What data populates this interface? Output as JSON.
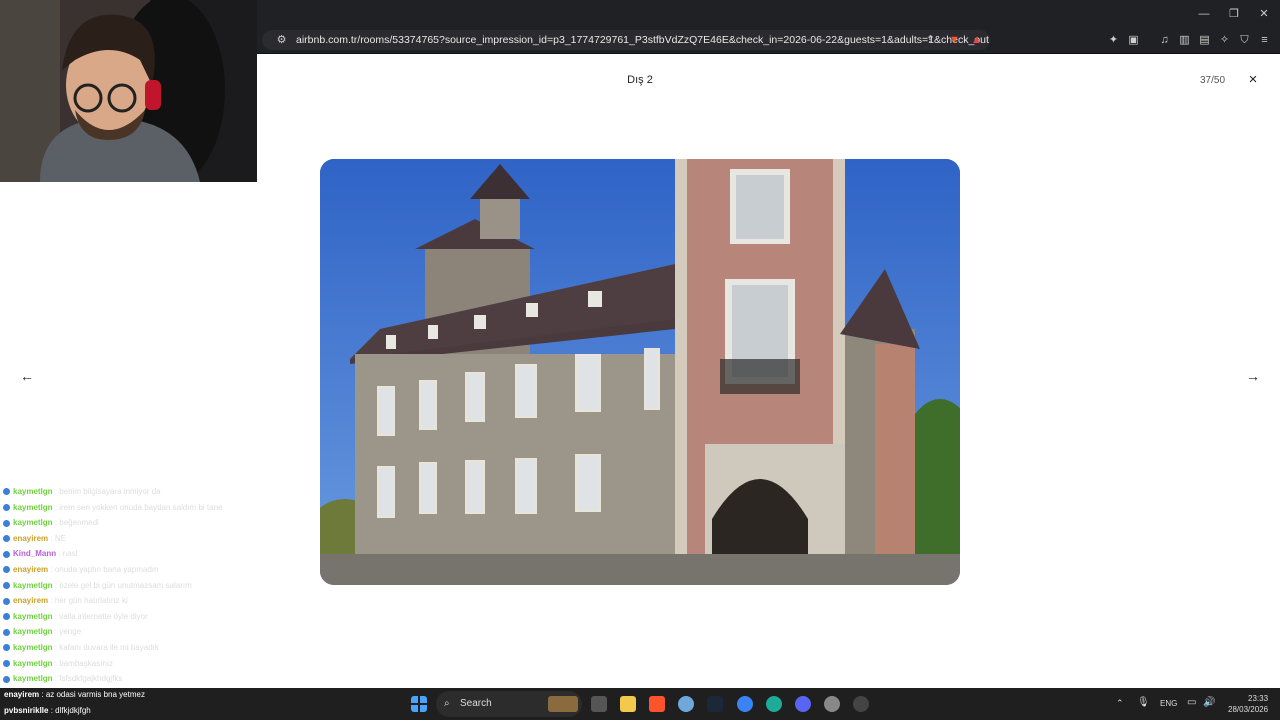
{
  "browser": {
    "url": "airbnb.com.tr/rooms/53374765?source_impression_id=p3_1774729761_P3stfbVdZzQ7E46E&check_in=2026-06-22&guests=1&adults=1&check_out..."
  },
  "viewer": {
    "title": "Dış 2",
    "counter": "37/50",
    "close_icon": "×",
    "prev_icon": "←",
    "next_icon": "→"
  },
  "chat": {
    "messages": [
      {
        "user": "kaymetlgn",
        "text": "benim bilgisayara inmiyor da",
        "color": "#6fd13f"
      },
      {
        "user": "kaymetlgn",
        "text": "irem sen yokken onuda baydan saldım bi tane",
        "color": "#6fd13f"
      },
      {
        "user": "kaymetlgn",
        "text": "beğenmedi",
        "color": "#6fd13f"
      },
      {
        "user": "enayirem",
        "text": "NE",
        "color": "#c9a227"
      },
      {
        "user": "Kind_Mann",
        "text": "nasl",
        "color": "#b85de0"
      },
      {
        "user": "enayirem",
        "text": "onuda yaptın bana yapmadın",
        "color": "#c9a227"
      },
      {
        "user": "kaymetlgn",
        "text": "özele gel bi gün unutmazsam salarım",
        "color": "#6fd13f"
      },
      {
        "user": "enayirem",
        "text": "her gün hatırlatırız ki",
        "color": "#c9a227"
      },
      {
        "user": "kaymetlgn",
        "text": "valla internette öyle diyor",
        "color": "#6fd13f"
      },
      {
        "user": "kaymetlgn",
        "text": "yenge",
        "color": "#6fd13f"
      },
      {
        "user": "kaymetlgn",
        "text": "kafanı duvara ile mi bayadık",
        "color": "#6fd13f"
      },
      {
        "user": "kaymetlgn",
        "text": "bambaşkasınız",
        "color": "#6fd13f"
      },
      {
        "user": "kaymetlgn",
        "text": "fsfsdkfgajkhdgjfks",
        "color": "#6fd13f"
      }
    ],
    "overlay": [
      {
        "user": "enayirem",
        "text": "az odasi varmis bna yetmez"
      },
      {
        "user": "pvbsniriklle",
        "text": "dlfkjdkjfgh"
      }
    ]
  },
  "taskbar": {
    "search_label": "Search",
    "language": "ENG",
    "time": "23:33",
    "date": "28/03/2026"
  },
  "colors": {
    "accent": "#ff385c",
    "brave": "#fb542b"
  }
}
